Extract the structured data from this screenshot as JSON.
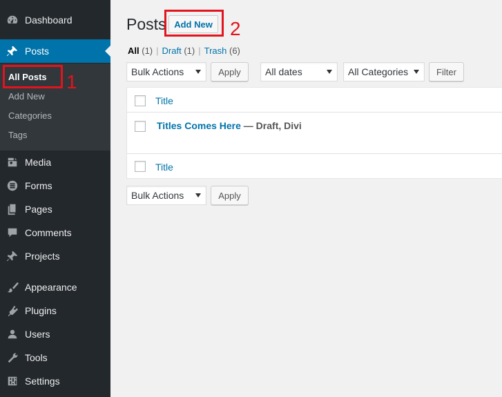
{
  "sidebar": {
    "items": [
      {
        "label": "Dashboard",
        "icon": "dashboard-icon"
      },
      {
        "label": "Posts",
        "icon": "pushpin-icon"
      },
      {
        "label": "Media",
        "icon": "media-icon"
      },
      {
        "label": "Forms",
        "icon": "forms-icon"
      },
      {
        "label": "Pages",
        "icon": "pages-icon"
      },
      {
        "label": "Comments",
        "icon": "comments-icon"
      },
      {
        "label": "Projects",
        "icon": "pushpin-icon"
      },
      {
        "label": "Appearance",
        "icon": "brush-icon"
      },
      {
        "label": "Plugins",
        "icon": "plugin-icon"
      },
      {
        "label": "Users",
        "icon": "users-icon"
      },
      {
        "label": "Tools",
        "icon": "wrench-icon"
      },
      {
        "label": "Settings",
        "icon": "settings-icon"
      }
    ],
    "submenu": [
      "All Posts",
      "Add New",
      "Categories",
      "Tags"
    ]
  },
  "main": {
    "page_title": "Posts",
    "add_new": "Add New",
    "annotations": {
      "one": "1",
      "two": "2"
    },
    "filters": {
      "all": "All",
      "all_count": "(1)",
      "draft": "Draft",
      "draft_count": "(1)",
      "trash": "Trash",
      "trash_count": "(6)",
      "separator": "|"
    },
    "bulk_actions": "Bulk Actions",
    "apply": "Apply",
    "all_dates": "All dates",
    "all_categories": "All Categories",
    "filter": "Filter",
    "table": {
      "column_title": "Title",
      "post_title": "Titles Comes Here",
      "post_state": "— Draft, Divi"
    }
  },
  "colors": {
    "sidebar_bg": "#23282d",
    "submenu_bg": "#32373c",
    "accent": "#0073aa",
    "annotation_red": "#e2141d"
  }
}
